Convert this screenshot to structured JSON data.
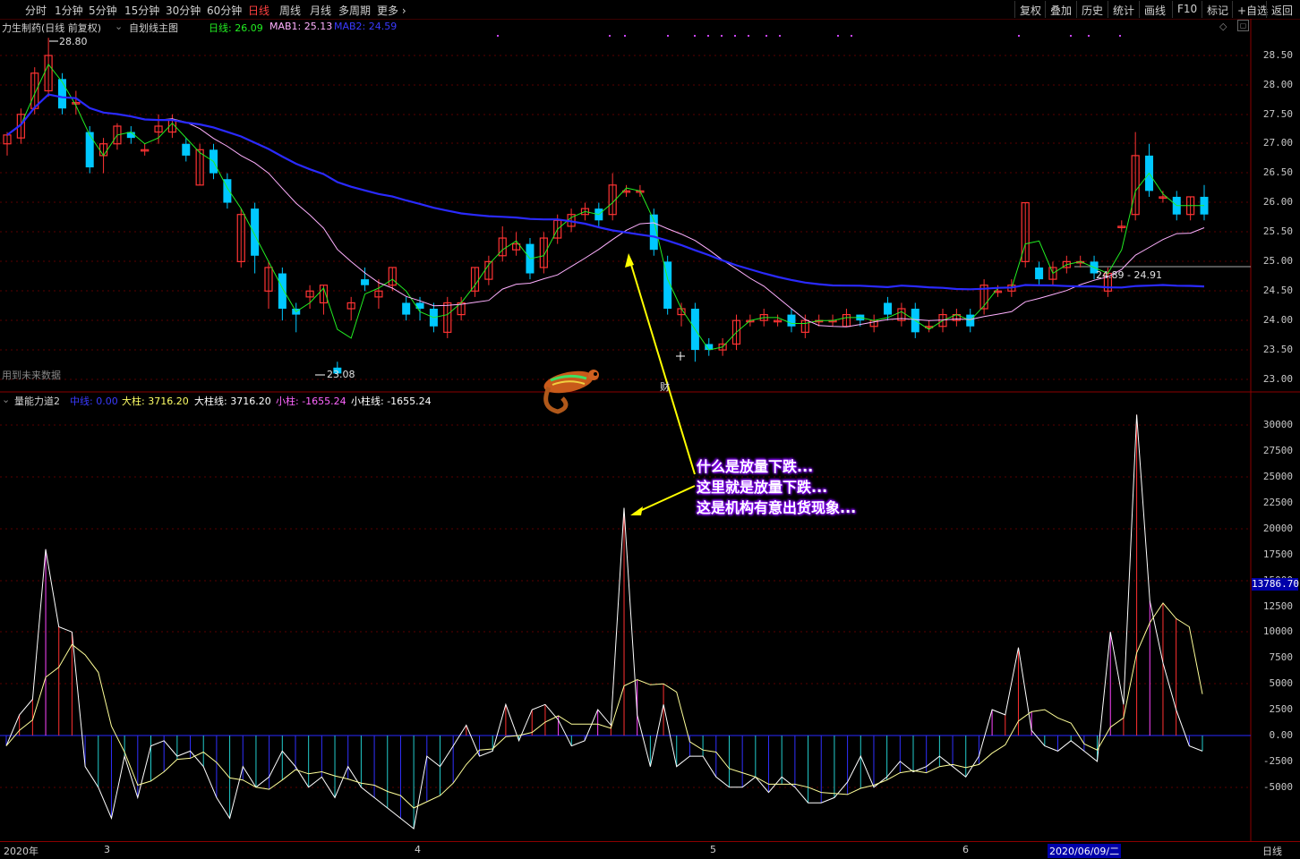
{
  "toolbar": {
    "periods": [
      "分时",
      "1分钟",
      "5分钟",
      "15分钟",
      "30分钟",
      "60分钟",
      "日线",
      "周线",
      "月线",
      "多周期",
      "更多"
    ],
    "active_period": "日线",
    "right_buttons": [
      "复权",
      "叠加",
      "历史",
      "统计",
      "画线",
      "F10",
      "标记",
      "+自选",
      "返回"
    ]
  },
  "main_panel": {
    "stock_name": "力生制药(日线 前复权)",
    "indicator_name": "自划线主图",
    "ma_line_label": "日线: 26.09",
    "mab1_label": "MAB1: 25.13",
    "mab2_label": "MAB2: 24.59",
    "high_label": "28.80",
    "low_label": "23.08",
    "range_label": "24.89 - 24.91",
    "future_data_note": "用到未来数据",
    "event_marker": "财",
    "price_axis": [
      "28.50",
      "28.00",
      "27.50",
      "27.00",
      "26.50",
      "26.00",
      "25.50",
      "25.00",
      "24.50",
      "24.00",
      "23.50",
      "23.00"
    ]
  },
  "sub_panel": {
    "indicator_name": "量能力道2",
    "mid_label": "中线: 0.00",
    "big_bar_label": "大柱: 3716.20",
    "big_line_label": "大柱线: 3716.20",
    "small_bar_label": "小柱: -1655.24",
    "small_line_label": "小柱线: -1655.24",
    "value_axis": [
      "30000",
      "27500",
      "25000",
      "22500",
      "20000",
      "17500",
      "15000",
      "12500",
      "10000",
      "7500",
      "5000",
      "2500",
      "0.00",
      "-2500",
      "-5000"
    ],
    "cursor_value": "13786.70"
  },
  "annotation": {
    "lines": [
      "什么是放量下跌...",
      "这里就是放量下跌...",
      "这是机构有意出货现象..."
    ]
  },
  "bottom_axis": {
    "labels": [
      "2020年",
      "3",
      "4",
      "5",
      "6"
    ],
    "cursor_date": "2020/06/09/二",
    "period_label": "日线"
  },
  "colors": {
    "up": "#ff3333",
    "down": "#00c8ff",
    "ma_green": "#22ee22",
    "mab1": "#ffb0ff",
    "mab2": "#2a2aff",
    "annot_glow": "#8a00ff",
    "arrow": "#ffff00"
  },
  "chart_data": {
    "type": "candlestick",
    "ylim": [
      22.9,
      28.8
    ],
    "candles": [
      {
        "o": 27.0,
        "c": 27.15,
        "h": 27.2,
        "l": 26.8
      },
      {
        "o": 27.1,
        "c": 27.5,
        "h": 27.6,
        "l": 27.0
      },
      {
        "o": 27.6,
        "c": 28.2,
        "h": 28.3,
        "l": 27.5
      },
      {
        "o": 27.9,
        "c": 28.5,
        "h": 28.8,
        "l": 27.8
      },
      {
        "o": 28.1,
        "c": 27.6,
        "h": 28.2,
        "l": 27.5
      },
      {
        "o": 27.7,
        "c": 27.7,
        "h": 27.9,
        "l": 27.5
      },
      {
        "o": 27.2,
        "c": 26.6,
        "h": 27.3,
        "l": 26.5
      },
      {
        "o": 26.8,
        "c": 27.0,
        "h": 27.1,
        "l": 26.5
      },
      {
        "o": 27.0,
        "c": 27.3,
        "h": 27.35,
        "l": 26.9
      },
      {
        "o": 27.2,
        "c": 27.1,
        "h": 27.3,
        "l": 27.0
      },
      {
        "o": 26.9,
        "c": 26.9,
        "h": 27.0,
        "l": 26.8
      },
      {
        "o": 27.2,
        "c": 27.3,
        "h": 27.5,
        "l": 27.0
      },
      {
        "o": 27.2,
        "c": 27.4,
        "h": 27.5,
        "l": 27.1
      },
      {
        "o": 27.0,
        "c": 26.8,
        "h": 27.1,
        "l": 26.7
      },
      {
        "o": 26.3,
        "c": 26.9,
        "h": 27.0,
        "l": 26.3
      },
      {
        "o": 26.9,
        "c": 26.5,
        "h": 27.0,
        "l": 26.4
      },
      {
        "o": 26.4,
        "c": 26.0,
        "h": 26.5,
        "l": 25.9
      },
      {
        "o": 25.0,
        "c": 25.8,
        "h": 25.9,
        "l": 24.9
      },
      {
        "o": 25.9,
        "c": 25.1,
        "h": 26.0,
        "l": 24.8
      },
      {
        "o": 24.5,
        "c": 24.9,
        "h": 25.0,
        "l": 24.2
      },
      {
        "o": 24.8,
        "c": 24.2,
        "h": 24.9,
        "l": 24.0
      },
      {
        "o": 24.2,
        "c": 24.1,
        "h": 24.3,
        "l": 23.8
      },
      {
        "o": 24.4,
        "c": 24.5,
        "h": 24.6,
        "l": 24.2
      },
      {
        "o": 24.3,
        "c": 24.6,
        "h": 24.6,
        "l": 24.1
      },
      {
        "o": 23.2,
        "c": 23.1,
        "h": 23.3,
        "l": 23.08
      },
      {
        "o": 24.2,
        "c": 24.3,
        "h": 24.4,
        "l": 24.0
      },
      {
        "o": 24.7,
        "c": 24.6,
        "h": 24.9,
        "l": 24.5
      },
      {
        "o": 24.4,
        "c": 24.5,
        "h": 24.7,
        "l": 24.2
      },
      {
        "o": 24.6,
        "c": 24.9,
        "h": 24.9,
        "l": 24.5
      },
      {
        "o": 24.3,
        "c": 24.1,
        "h": 24.4,
        "l": 24.0
      },
      {
        "o": 24.3,
        "c": 24.2,
        "h": 24.4,
        "l": 24.0
      },
      {
        "o": 24.2,
        "c": 23.9,
        "h": 24.3,
        "l": 23.8
      },
      {
        "o": 23.8,
        "c": 24.3,
        "h": 24.4,
        "l": 23.7
      },
      {
        "o": 24.1,
        "c": 24.3,
        "h": 24.4,
        "l": 24.0
      },
      {
        "o": 24.5,
        "c": 24.9,
        "h": 24.9,
        "l": 24.4
      },
      {
        "o": 24.7,
        "c": 25.0,
        "h": 25.1,
        "l": 24.6
      },
      {
        "o": 25.1,
        "c": 25.4,
        "h": 25.6,
        "l": 25.0
      },
      {
        "o": 25.2,
        "c": 25.3,
        "h": 25.5,
        "l": 25.1
      },
      {
        "o": 25.3,
        "c": 24.8,
        "h": 25.4,
        "l": 24.7
      },
      {
        "o": 24.9,
        "c": 25.4,
        "h": 25.5,
        "l": 24.8
      },
      {
        "o": 25.4,
        "c": 25.7,
        "h": 25.8,
        "l": 25.3
      },
      {
        "o": 25.6,
        "c": 25.8,
        "h": 25.9,
        "l": 25.5
      },
      {
        "o": 25.8,
        "c": 25.9,
        "h": 26.0,
        "l": 25.7
      },
      {
        "o": 25.9,
        "c": 25.7,
        "h": 26.0,
        "l": 25.6
      },
      {
        "o": 25.8,
        "c": 26.3,
        "h": 26.5,
        "l": 25.7
      },
      {
        "o": 26.2,
        "c": 26.2,
        "h": 26.3,
        "l": 26.1
      },
      {
        "o": 26.2,
        "c": 26.2,
        "h": 26.3,
        "l": 26.1
      },
      {
        "o": 25.8,
        "c": 25.2,
        "h": 25.9,
        "l": 25.1
      },
      {
        "o": 25.0,
        "c": 24.2,
        "h": 25.1,
        "l": 24.1
      },
      {
        "o": 24.1,
        "c": 24.2,
        "h": 24.3,
        "l": 23.9
      },
      {
        "o": 24.2,
        "c": 23.5,
        "h": 24.3,
        "l": 23.3
      },
      {
        "o": 23.6,
        "c": 23.5,
        "h": 23.7,
        "l": 23.4
      },
      {
        "o": 23.5,
        "c": 23.6,
        "h": 23.7,
        "l": 23.4
      },
      {
        "o": 23.6,
        "c": 24.0,
        "h": 24.1,
        "l": 23.5
      },
      {
        "o": 24.0,
        "c": 24.0,
        "h": 24.1,
        "l": 23.9
      },
      {
        "o": 24.0,
        "c": 24.1,
        "h": 24.2,
        "l": 23.9
      },
      {
        "o": 24.0,
        "c": 24.0,
        "h": 24.1,
        "l": 23.9
      },
      {
        "o": 24.1,
        "c": 23.9,
        "h": 24.2,
        "l": 23.8
      },
      {
        "o": 23.8,
        "c": 24.0,
        "h": 24.1,
        "l": 23.7
      },
      {
        "o": 24.0,
        "c": 24.0,
        "h": 24.1,
        "l": 23.9
      },
      {
        "o": 24.0,
        "c": 24.0,
        "h": 24.1,
        "l": 23.9
      },
      {
        "o": 23.9,
        "c": 24.1,
        "h": 24.2,
        "l": 23.9
      },
      {
        "o": 24.1,
        "c": 24.0,
        "h": 24.1,
        "l": 23.9
      },
      {
        "o": 23.9,
        "c": 24.0,
        "h": 24.1,
        "l": 23.8
      },
      {
        "o": 24.3,
        "c": 24.1,
        "h": 24.4,
        "l": 24.0
      },
      {
        "o": 24.0,
        "c": 24.2,
        "h": 24.3,
        "l": 23.9
      },
      {
        "o": 24.2,
        "c": 23.8,
        "h": 24.3,
        "l": 23.7
      },
      {
        "o": 23.9,
        "c": 23.9,
        "h": 24.0,
        "l": 23.8
      },
      {
        "o": 23.9,
        "c": 24.1,
        "h": 24.2,
        "l": 23.8
      },
      {
        "o": 24.0,
        "c": 24.1,
        "h": 24.2,
        "l": 23.9
      },
      {
        "o": 24.1,
        "c": 23.9,
        "h": 24.2,
        "l": 23.8
      },
      {
        "o": 24.2,
        "c": 24.6,
        "h": 24.7,
        "l": 24.1
      },
      {
        "o": 24.5,
        "c": 24.5,
        "h": 24.6,
        "l": 24.4
      },
      {
        "o": 24.5,
        "c": 24.6,
        "h": 24.7,
        "l": 24.4
      },
      {
        "o": 25.0,
        "c": 26.0,
        "h": 26.0,
        "l": 24.9
      },
      {
        "o": 24.9,
        "c": 24.7,
        "h": 25.0,
        "l": 24.6
      },
      {
        "o": 24.7,
        "c": 24.9,
        "h": 25.0,
        "l": 24.6
      },
      {
        "o": 24.9,
        "c": 25.0,
        "h": 25.1,
        "l": 24.8
      },
      {
        "o": 25.0,
        "c": 25.0,
        "h": 25.1,
        "l": 24.9
      },
      {
        "o": 25.0,
        "c": 24.8,
        "h": 25.1,
        "l": 24.7
      },
      {
        "o": 24.5,
        "c": 24.8,
        "h": 24.9,
        "l": 24.4
      },
      {
        "o": 25.6,
        "c": 25.6,
        "h": 25.7,
        "l": 25.5
      },
      {
        "o": 25.8,
        "c": 26.8,
        "h": 27.2,
        "l": 25.7
      },
      {
        "o": 26.8,
        "c": 26.2,
        "h": 27.0,
        "l": 26.1
      },
      {
        "o": 26.1,
        "c": 26.1,
        "h": 26.2,
        "l": 26.0
      },
      {
        "o": 26.1,
        "c": 25.8,
        "h": 26.2,
        "l": 25.7
      },
      {
        "o": 25.8,
        "c": 26.1,
        "h": 26.1,
        "l": 25.7
      },
      {
        "o": 26.1,
        "c": 25.8,
        "h": 26.3,
        "l": 25.7
      }
    ],
    "volume_force": [
      -1000,
      2000,
      3500,
      18000,
      10500,
      10000,
      -3000,
      -5000,
      -8000,
      -2000,
      -6000,
      -1000,
      -500,
      -2000,
      -1500,
      -3000,
      -6000,
      -8000,
      -3000,
      -5000,
      -4000,
      -1500,
      -3000,
      -5000,
      -4000,
      -6000,
      -3000,
      -5000,
      -6000,
      -7000,
      -8000,
      -9000,
      -2000,
      -3000,
      -1000,
      1000,
      -2000,
      -1500,
      3000,
      -500,
      2500,
      3000,
      1500,
      -1000,
      -500,
      2500,
      1000,
      22000,
      2000,
      -3000,
      3000,
      -3000,
      -2000,
      -2000,
      -4000,
      -5000,
      -5000,
      -4000,
      -5500,
      -4000,
      -5000,
      -6500,
      -6500,
      -6000,
      -4500,
      -2000,
      -5000,
      -4000,
      -2500,
      -3500,
      -3000,
      -2000,
      -3000,
      -4000,
      -2000,
      2500,
      2000,
      8500,
      500,
      -1000,
      -1500,
      -500,
      -1500,
      -2500,
      10000,
      3000,
      31000,
      13000,
      7000,
      2500,
      -1000,
      -1500
    ]
  }
}
